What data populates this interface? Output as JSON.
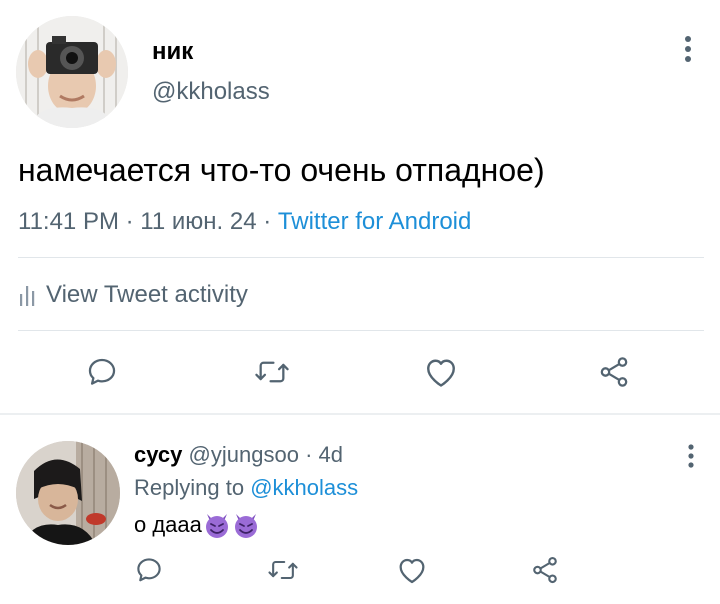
{
  "tweet": {
    "name": "ник",
    "handle": "@kkholass",
    "text": "намечается что-то очень отпадное)",
    "time": "11:41 PM",
    "date": "11 июн. 24",
    "source": "Twitter for Android",
    "activity_label": "View Tweet activity"
  },
  "reply": {
    "name": "сусу",
    "handle": "@yjungsoo",
    "time": "4d",
    "replying_prefix": "Replying to",
    "replying_to": "@kkholass",
    "text": "о дааа",
    "emoji": [
      "smiling-imp-emoji",
      "smiling-imp-emoji"
    ]
  },
  "colors": {
    "text": "#0f1419",
    "secondary": "#536471",
    "link": "#1d8fd8",
    "divider": "#e1e6ea",
    "emoji_purple": "#9a6bd6"
  },
  "icons": [
    "more-vertical-icon",
    "bar-chart-icon",
    "reply-icon",
    "retweet-icon",
    "like-icon",
    "share-icon"
  ]
}
